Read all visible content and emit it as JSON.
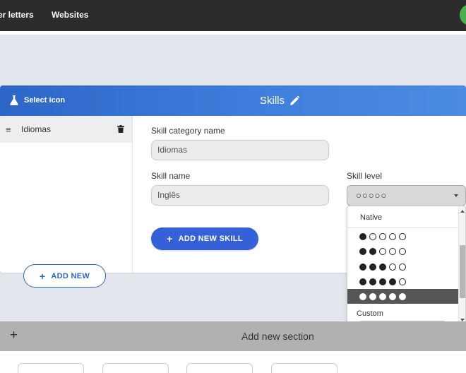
{
  "nav": {
    "links": [
      "er letters",
      "Websites"
    ]
  },
  "card": {
    "select_icon_label": "Select icon",
    "title": "Skills",
    "category": {
      "label": "Idiomas"
    },
    "add_new_label": "ADD NEW",
    "form": {
      "category_name_label": "Skill category name",
      "category_name_value": "Idiomas",
      "skill_name_label": "Skill name",
      "skill_name_value": "Inglês",
      "skill_level_label": "Skill level",
      "skill_level_value": "○○○○○",
      "add_skill_label": "ADD NEW SKILL"
    }
  },
  "dropdown": {
    "native_label": "Native",
    "levels": [
      {
        "filled": 1,
        "total": 5
      },
      {
        "filled": 2,
        "total": 5
      },
      {
        "filled": 3,
        "total": 5
      },
      {
        "filled": 4,
        "total": 5
      },
      {
        "filled": 5,
        "total": 5,
        "selected": true
      }
    ],
    "custom_label": "Custom"
  },
  "add_section": {
    "plus": "+",
    "label": "Add new section"
  },
  "colors": {
    "header_blue": "#2d66c6",
    "button_blue": "#3660d8",
    "nav_bg": "#2c2c2c",
    "selected_item": "#555555"
  }
}
